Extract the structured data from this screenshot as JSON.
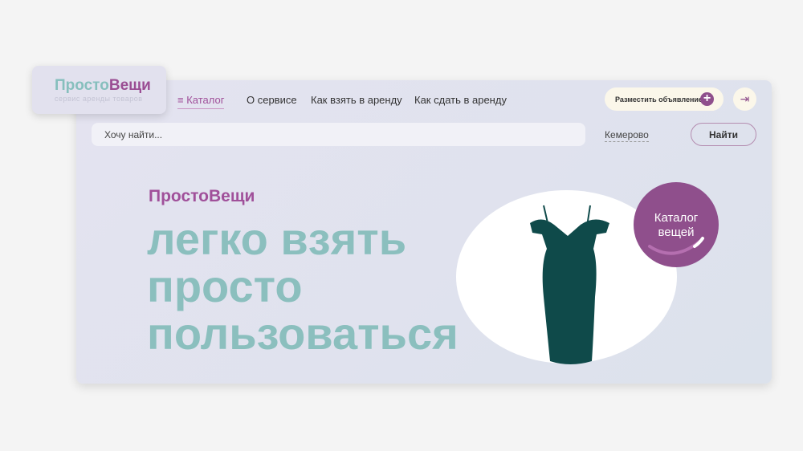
{
  "logo": {
    "part1": "Просто",
    "part2": "Вещи",
    "tagline": "сервис аренды товаров"
  },
  "nav": {
    "catalog": "Каталог",
    "about": "О сервисе",
    "how_rent": "Как взять в аренду",
    "how_lend": "Как сдать в аренду"
  },
  "header": {
    "post_ad": "Разместить объявление"
  },
  "search": {
    "placeholder": "Хочу найти...",
    "city": "Кемерово",
    "button": "Найти"
  },
  "hero": {
    "brand": "ПростоВещи",
    "line1": "легко взять",
    "line2": "просто",
    "line3": "пользоваться",
    "badge_line1": "Каталог",
    "badge_line2": "вещей"
  },
  "colors": {
    "purple": "#8f4f8c",
    "teal": "#8bbfbe"
  }
}
